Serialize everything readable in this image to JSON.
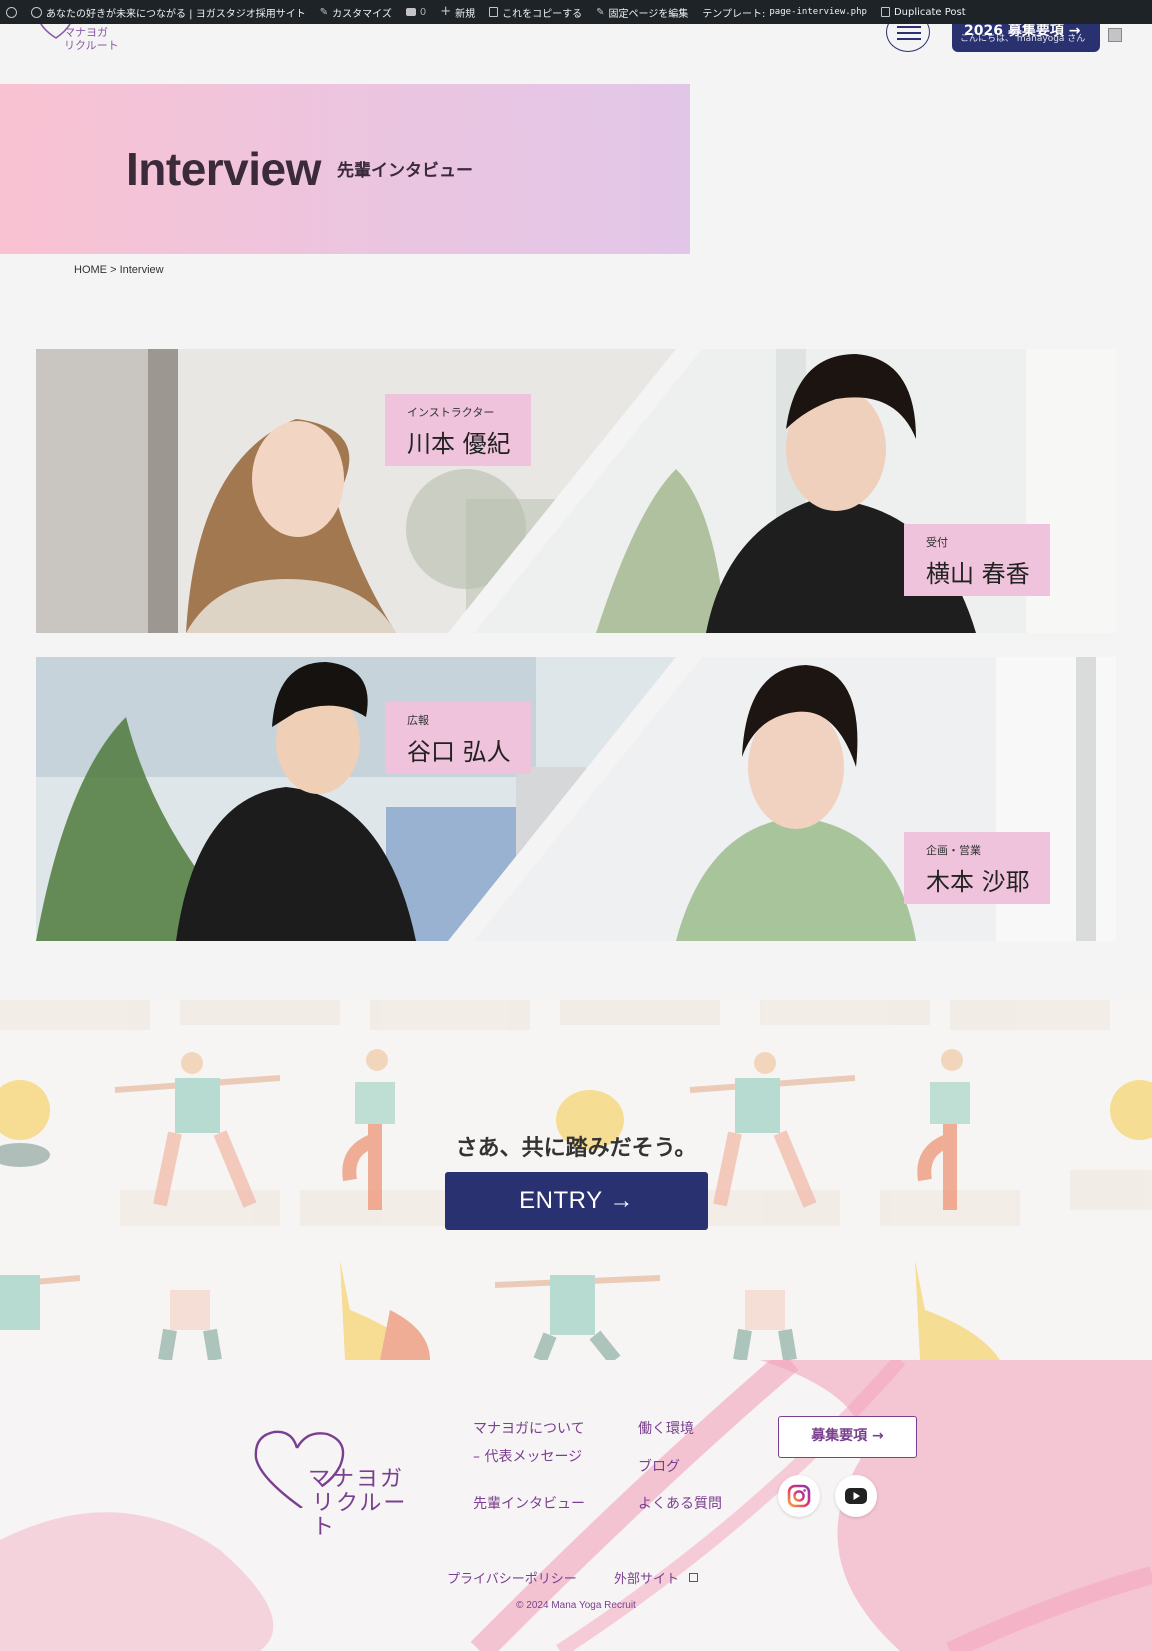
{
  "admin_bar": {
    "site_name": "あなたの好きが未来につながる | ヨガスタジオ採用サイト",
    "customize": "カスタマイズ",
    "comments_count": "0",
    "new": "新規",
    "copy": "これをコピーする",
    "edit_page": "固定ページを編集",
    "template_label": "テンプレート:",
    "template_file": "page-interview.php",
    "duplicate": "Duplicate Post",
    "greeting": "こんにちは、 manayoga さん"
  },
  "header": {
    "logo_line1": "マナヨガ",
    "logo_line2": "リクルート",
    "recruit_button": "2026 募集要項 →"
  },
  "hero": {
    "title": "Interview",
    "subtitle": "先輩インタビュー"
  },
  "breadcrumb": {
    "home": "HOME",
    "separator": ">",
    "current": "Interview"
  },
  "interviews": [
    {
      "role": "インストラクター",
      "name": "川本 優紀"
    },
    {
      "role": "受付",
      "name": "横山 春香"
    },
    {
      "role": "広報",
      "name": "谷口 弘人"
    },
    {
      "role": "企画・営業",
      "name": "木本 沙耶"
    }
  ],
  "entry": {
    "catch": "さあ、共に踏みだそう。",
    "button": "ENTRY →"
  },
  "footer": {
    "logo_line1": "マナヨガ",
    "logo_line2": "リクルート",
    "nav": {
      "about": "マナヨガについて",
      "message": "– 代表メッセージ",
      "interview": "先輩インタビュー",
      "environment": "働く環境",
      "blog": "ブログ",
      "faq": "よくある質問"
    },
    "recruit_button": "募集要項 →",
    "privacy": "プライバシーポリシー",
    "external": "外部サイト",
    "copyright": "© 2024 Mana Yoga Recruit"
  },
  "colors": {
    "navy": "#2a3170",
    "purple": "#7a3f8f",
    "pink": "#f9c2d2",
    "lavender": "#e2c6e8",
    "nameplate": "#efc3dc"
  }
}
